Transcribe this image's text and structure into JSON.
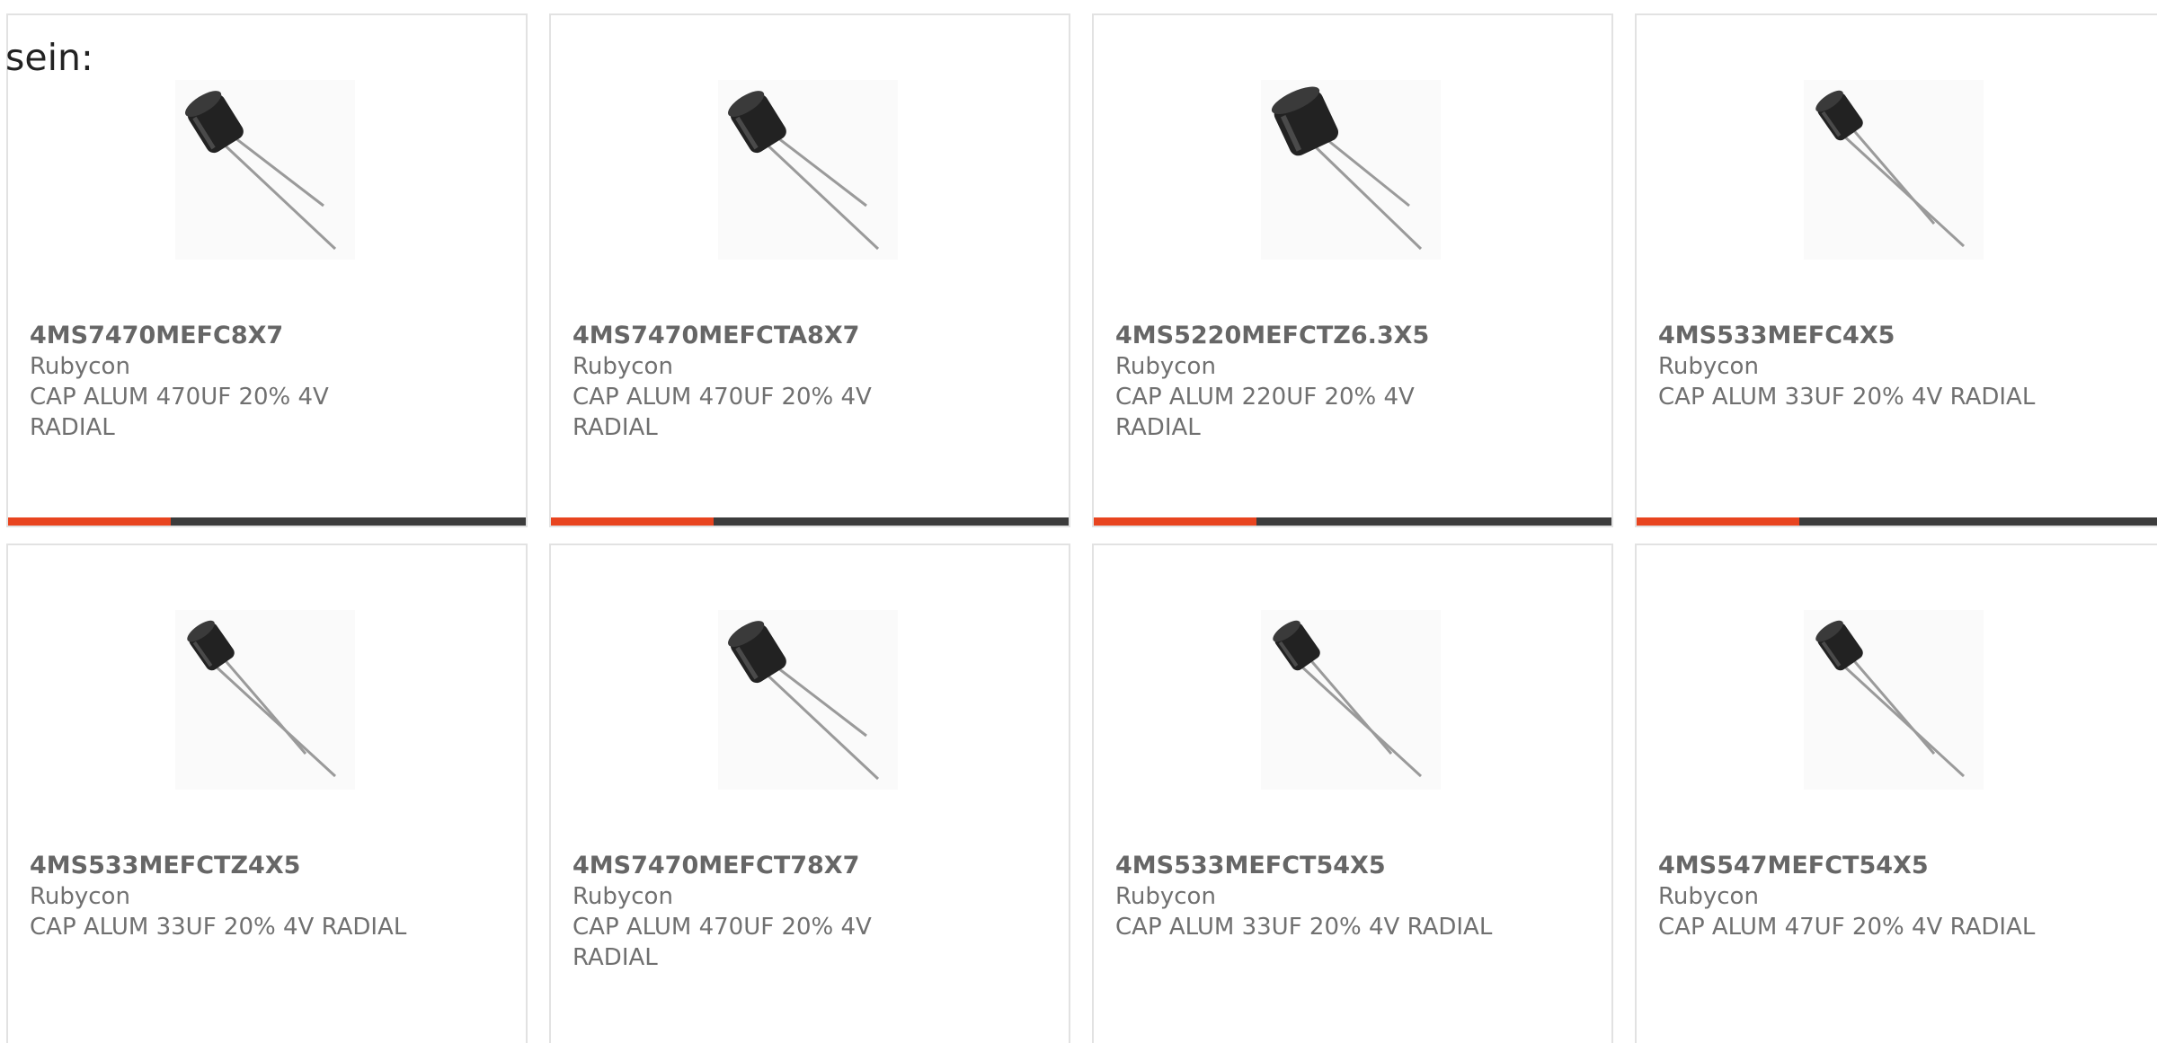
{
  "intro": {
    "text": "sein:"
  },
  "accent_color": "#e8441f",
  "bar_color": "#3c3c3c",
  "products": [
    {
      "part_number": "4MS7470MEFC8X7",
      "manufacturer": "Rubycon",
      "description": "CAP ALUM 470UF 20% 4V RADIAL",
      "image_icon": "radial-capacitor-icon"
    },
    {
      "part_number": "4MS7470MEFCTA8X7",
      "manufacturer": "Rubycon",
      "description": "CAP ALUM 470UF 20% 4V RADIAL",
      "image_icon": "radial-capacitor-icon"
    },
    {
      "part_number": "4MS5220MEFCTZ6.3X5",
      "manufacturer": "Rubycon",
      "description": "CAP ALUM 220UF 20% 4V RADIAL",
      "image_icon": "radial-capacitor-icon"
    },
    {
      "part_number": "4MS533MEFC4X5",
      "manufacturer": "Rubycon",
      "description": "CAP ALUM 33UF 20% 4V RADIAL",
      "image_icon": "radial-capacitor-icon"
    },
    {
      "part_number": "4MS533MEFCTZ4X5",
      "manufacturer": "Rubycon",
      "description": "CAP ALUM 33UF 20% 4V RADIAL",
      "image_icon": "radial-capacitor-icon"
    },
    {
      "part_number": "4MS7470MEFCT78X7",
      "manufacturer": "Rubycon",
      "description": "CAP ALUM 470UF 20% 4V RADIAL",
      "image_icon": "radial-capacitor-icon"
    },
    {
      "part_number": "4MS533MEFCT54X5",
      "manufacturer": "Rubycon",
      "description": "CAP ALUM 33UF 20% 4V RADIAL",
      "image_icon": "radial-capacitor-icon"
    },
    {
      "part_number": "4MS547MEFCT54X5",
      "manufacturer": "Rubycon",
      "description": "CAP ALUM 47UF 20% 4V RADIAL",
      "image_icon": "radial-capacitor-icon"
    }
  ]
}
